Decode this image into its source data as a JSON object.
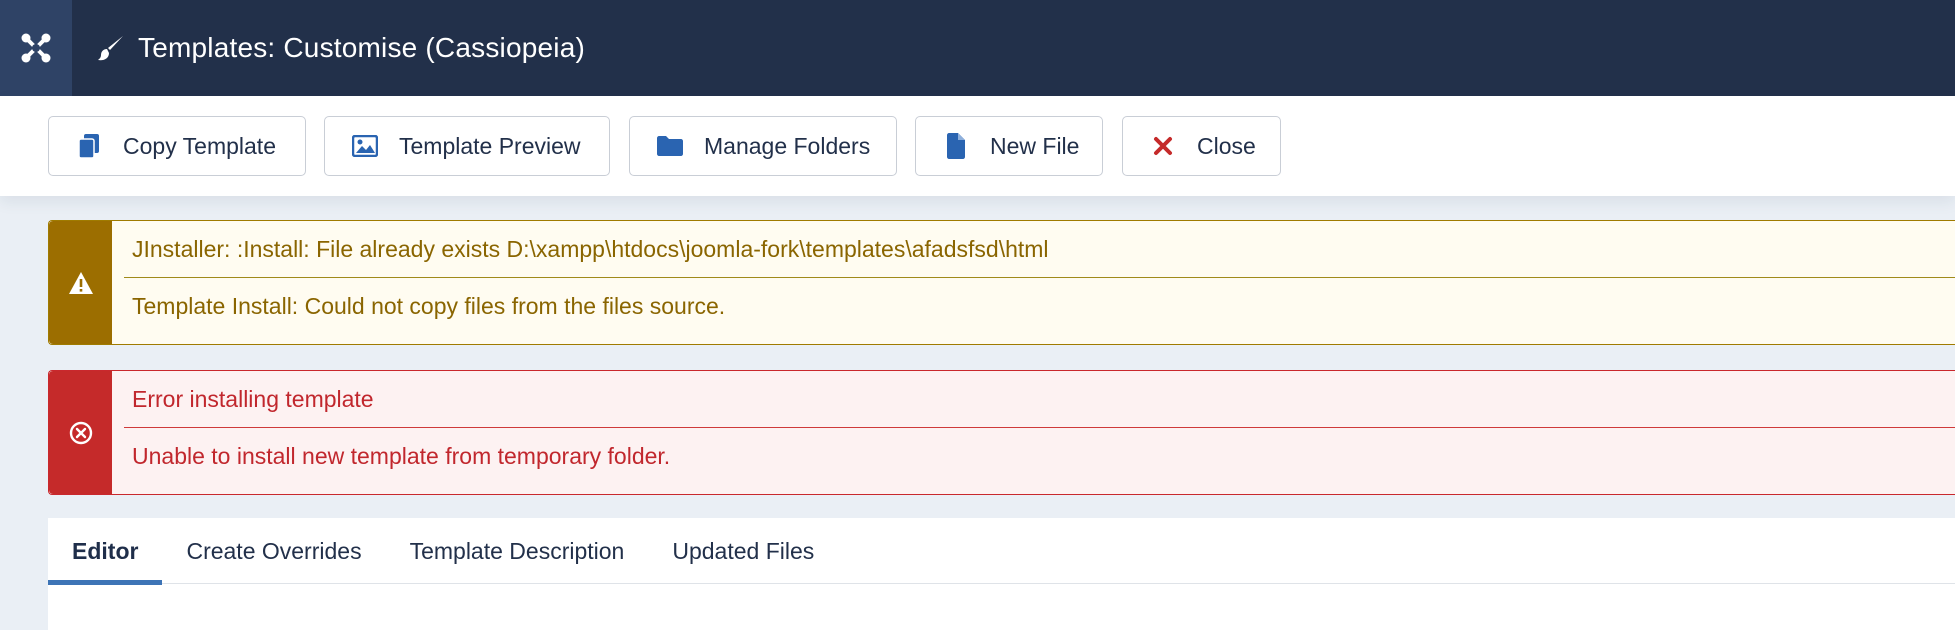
{
  "header": {
    "title": "Templates: Customise (Cassiopeia)",
    "logo_icon": "joomla-logo-icon",
    "title_icon": "paint-brush-icon"
  },
  "toolbar": {
    "buttons": [
      {
        "label": "Copy Template",
        "icon": "copy-icon"
      },
      {
        "label": "Template Preview",
        "icon": "image-icon"
      },
      {
        "label": "Manage Folders",
        "icon": "folder-icon"
      },
      {
        "label": "New File",
        "icon": "file-icon"
      },
      {
        "label": "Close",
        "icon": "close-icon"
      }
    ]
  },
  "alerts": {
    "warning": {
      "icon": "warning-icon",
      "messages": [
        "JInstaller: :Install: File already exists D:\\xampp\\htdocs\\joomla-fork\\templates\\afadsfsd\\html",
        "Template Install: Could not copy files from the files source."
      ]
    },
    "error": {
      "icon": "error-circle-icon",
      "messages": [
        "Error installing template",
        "Unable to install new template from temporary folder."
      ]
    }
  },
  "tabs": [
    {
      "label": "Editor",
      "active": true
    },
    {
      "label": "Create Overrides",
      "active": false
    },
    {
      "label": "Template Description",
      "active": false
    },
    {
      "label": "Updated Files",
      "active": false
    }
  ],
  "colors": {
    "header_bg": "#22304a",
    "warning": "#9c6e00",
    "error": "#c52a2a",
    "accent": "#3d74b6"
  }
}
